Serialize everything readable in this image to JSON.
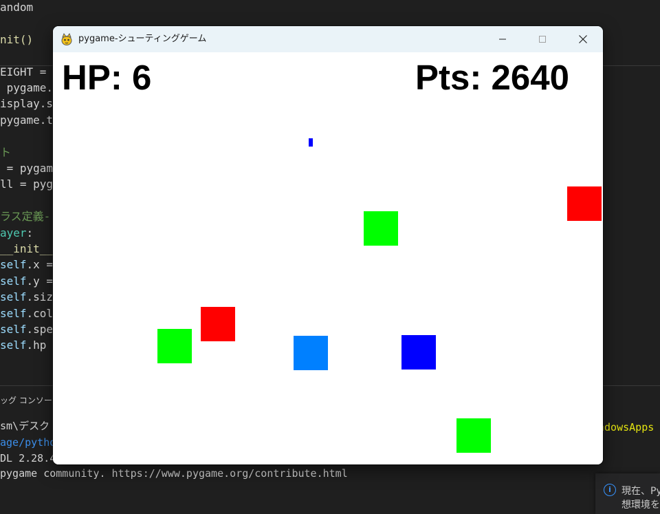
{
  "editor": {
    "lines": [
      {
        "segments": [
          {
            "text": "andom",
            "cls": "c-plain"
          }
        ]
      },
      {
        "segments": []
      },
      {
        "segments": [
          {
            "text": "nit()",
            "cls": "c-func"
          }
        ]
      },
      {
        "segments": []
      },
      {
        "segments": [
          {
            "text": "EIGHT = ",
            "cls": "c-plain"
          }
        ]
      },
      {
        "segments": [
          {
            "text": " pygame.",
            "cls": "c-plain"
          }
        ]
      },
      {
        "segments": [
          {
            "text": "isplay.s",
            "cls": "c-plain"
          }
        ]
      },
      {
        "segments": [
          {
            "text": "pygame.t",
            "cls": "c-plain"
          }
        ]
      },
      {
        "segments": []
      },
      {
        "segments": [
          {
            "text": "ト",
            "cls": "c-comment"
          }
        ]
      },
      {
        "segments": [
          {
            "text": " = pygam",
            "cls": "c-plain"
          }
        ]
      },
      {
        "segments": [
          {
            "text": "ll = pyg",
            "cls": "c-plain"
          }
        ]
      },
      {
        "segments": []
      },
      {
        "segments": [
          {
            "text": "ラス定義-",
            "cls": "c-comment"
          }
        ]
      },
      {
        "segments": [
          {
            "text": "ayer",
            "cls": "c-class"
          },
          {
            "text": ":",
            "cls": "c-plain"
          }
        ]
      },
      {
        "segments": [
          {
            "text": "__init__",
            "cls": "c-func"
          }
        ]
      },
      {
        "segments": [
          {
            "text": "self",
            "cls": "c-var"
          },
          {
            "text": ".x =",
            "cls": "c-plain"
          }
        ]
      },
      {
        "segments": [
          {
            "text": "self",
            "cls": "c-var"
          },
          {
            "text": ".y =",
            "cls": "c-plain"
          }
        ]
      },
      {
        "segments": [
          {
            "text": "self",
            "cls": "c-var"
          },
          {
            "text": ".siz",
            "cls": "c-plain"
          }
        ]
      },
      {
        "segments": [
          {
            "text": "self",
            "cls": "c-var"
          },
          {
            "text": ".col",
            "cls": "c-plain"
          }
        ]
      },
      {
        "segments": [
          {
            "text": "self",
            "cls": "c-var"
          },
          {
            "text": ".spe",
            "cls": "c-plain"
          }
        ]
      },
      {
        "segments": [
          {
            "text": "self",
            "cls": "c-var"
          },
          {
            "text": ".hp",
            "cls": "c-plain"
          }
        ]
      }
    ]
  },
  "panel": {
    "tab_label": "ッグ コンソール"
  },
  "terminal": {
    "lines": [
      {
        "segments": [
          {
            "text": "sm\\デスク",
            "cls": "c-plain"
          }
        ]
      },
      {
        "segments": [
          {
            "text": "age/pytho",
            "cls": "term-link"
          }
        ]
      },
      {
        "segments": [
          {
            "text": "DL 2.28.4",
            "cls": "c-plain"
          }
        ]
      },
      {
        "segments": [
          {
            "text": "pygame community. https://www.pygame.org/contribute.html",
            "cls": "c-plain"
          }
        ]
      }
    ],
    "right_fragment": "ndowsApps"
  },
  "notification": {
    "text_line1": "現在、Py",
    "text_line2": "想環境を"
  },
  "window": {
    "title": "pygame-シューティングゲーム",
    "minimize_label": "minimize",
    "maximize_label": "maximize",
    "close_label": "close"
  },
  "game": {
    "hp_label": "HP: 6",
    "points_label": "Pts: 2640",
    "hp": 6,
    "points": 2640,
    "colors": {
      "red": "#ff0000",
      "green": "#00ff00",
      "blue": "#0000ff",
      "player": "#0080ff",
      "bullet": "#0000ff"
    },
    "sprites": [
      {
        "kind": "enemy",
        "color": "red"
      },
      {
        "kind": "enemy",
        "color": "green"
      },
      {
        "kind": "enemy",
        "color": "red"
      },
      {
        "kind": "enemy",
        "color": "green"
      },
      {
        "kind": "player",
        "color": "player"
      },
      {
        "kind": "enemy",
        "color": "blue"
      },
      {
        "kind": "enemy",
        "color": "green"
      },
      {
        "kind": "bullet",
        "color": "bullet"
      }
    ]
  }
}
